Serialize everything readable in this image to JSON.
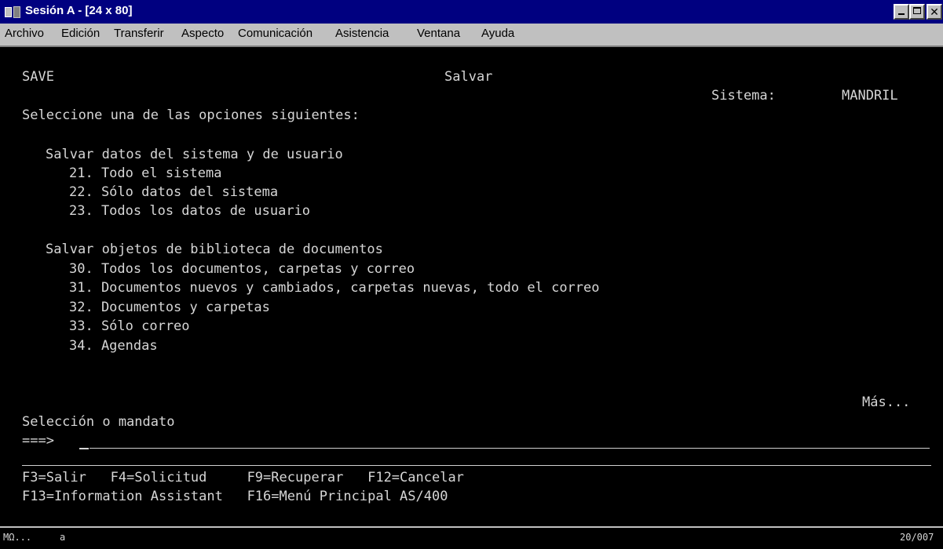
{
  "window": {
    "title": "Sesión A - [24 x 80]"
  },
  "menu": {
    "items": [
      {
        "label": "Archivo"
      },
      {
        "label": "Edición"
      },
      {
        "label": "Transferir"
      },
      {
        "label": "Aspecto"
      },
      {
        "label": "Comunicación"
      },
      {
        "label": "Asistencia"
      },
      {
        "label": "Ventana"
      },
      {
        "label": "Ayuda"
      }
    ]
  },
  "screen": {
    "menu_id": "SAVE",
    "title": "Salvar",
    "system_label": "Sistema:",
    "system_name": "MANDRIL",
    "instruction": "Seleccione una de las opciones siguientes:",
    "groups": [
      {
        "heading": "Salvar datos del sistema y de usuario",
        "options": [
          {
            "text": "21. Todo el sistema"
          },
          {
            "text": "22. Sólo datos del sistema"
          },
          {
            "text": "23. Todos los datos de usuario"
          }
        ]
      },
      {
        "heading": "Salvar objetos de biblioteca de documentos",
        "options": [
          {
            "text": "30. Todos los documentos, carpetas y correo"
          },
          {
            "text": "31. Documentos nuevos y cambiados, carpetas nuevas, todo el correo"
          },
          {
            "text": "32. Documentos y carpetas"
          },
          {
            "text": "33. Sólo correo"
          },
          {
            "text": "34. Agendas"
          }
        ]
      }
    ],
    "more": "Más...",
    "command_label": "Selección o mandato",
    "prompt": "===>",
    "command_value": "",
    "function_keys_row1": "F3=Salir   F4=Solicitud     F9=Recuperar   F12=Cancelar",
    "function_keys_row2": "F13=Information Assistant   F16=Menú Principal AS/400"
  },
  "status": {
    "left": "MΩ...",
    "mid": "a",
    "right": "20/007"
  }
}
